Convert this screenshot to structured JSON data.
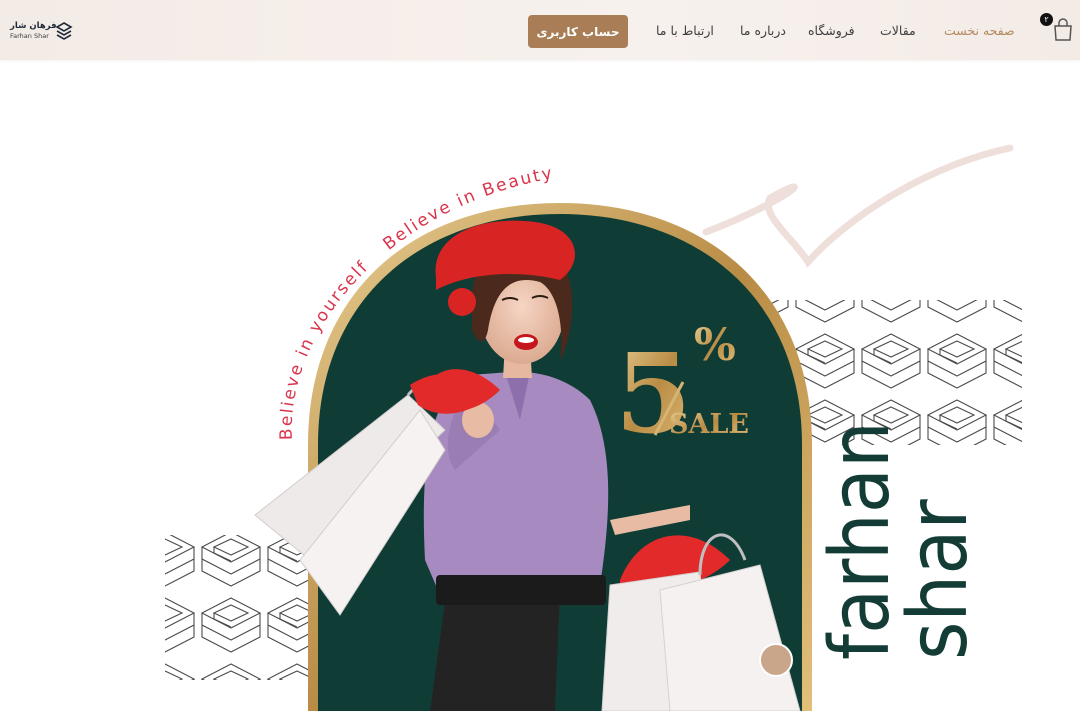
{
  "logo": {
    "name": "فرهان شار",
    "subtitle": "Farhan Shar"
  },
  "header": {
    "account_button": "حساب کاربری",
    "cart_count": "۲",
    "nav": [
      {
        "label": "صفحه نخست",
        "active": true
      },
      {
        "label": "مقالات",
        "active": false
      },
      {
        "label": "فروشگاه",
        "active": false
      },
      {
        "label": "درباره ما",
        "active": false
      },
      {
        "label": "ارتباط با ما",
        "active": false
      }
    ]
  },
  "hero": {
    "tagline_1": "Believe in yourself",
    "tagline_2": "Believe in Beauty",
    "discount": "5",
    "percent": "%",
    "sale": "SALE",
    "brand_line_1": "farhan",
    "brand_line_2": "shar"
  },
  "colors": {
    "accent": "#a97d55",
    "active_link": "#b3895f",
    "arch": "#103c36",
    "gold": "#c9a56b",
    "tagline": "#d9344b"
  }
}
